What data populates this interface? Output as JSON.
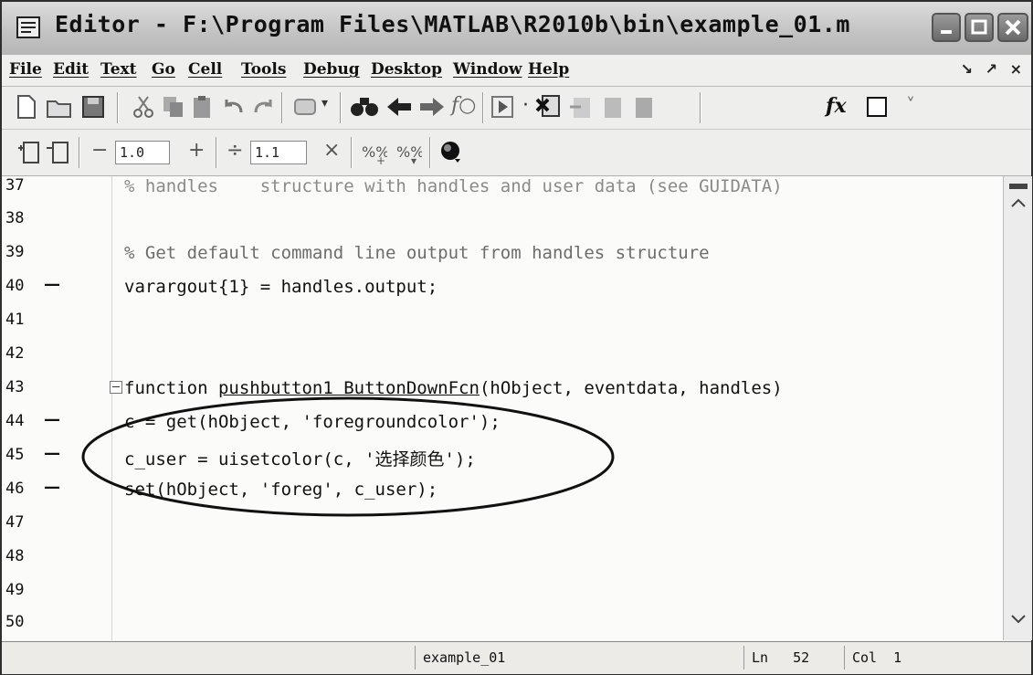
{
  "window": {
    "title": "Editor - F:\\Program Files\\MATLAB\\R2010b\\bin\\example_01.m"
  },
  "menu": [
    "File",
    "Edit",
    "Text",
    "Go",
    "Cell",
    "Tools",
    "Debug",
    "Desktop",
    "Window",
    "Help"
  ],
  "dock_controls": "↘ ↗ ×",
  "toolbar_cell": {
    "minus": "−",
    "value1": "1.0",
    "plus": "+",
    "divide": "÷",
    "value2": "1.1",
    "times": "×"
  },
  "lines": [
    {
      "num": "37",
      "dash": "",
      "code": "% handles    structure with handles and user data (see GUIDATA)"
    },
    {
      "num": "38",
      "dash": "",
      "code": ""
    },
    {
      "num": "39",
      "dash": "",
      "code": "% Get default command line output from handles structure"
    },
    {
      "num": "40",
      "dash": "—",
      "code": "varargout{1} = handles.output;"
    },
    {
      "num": "41",
      "dash": "",
      "code": ""
    },
    {
      "num": "42",
      "dash": "",
      "code": ""
    },
    {
      "num": "43",
      "dash": "",
      "code_pre": "function ",
      "code_ul": "pushbutton1_ButtonDownFcn",
      "code_post": "(hObject, eventdata, handles)"
    },
    {
      "num": "44",
      "dash": "—",
      "code": "c = get(hObject, 'foregroundcolor');"
    },
    {
      "num": "45",
      "dash": "—",
      "code": "c_user = uisetcolor(c, '选择颜色');"
    },
    {
      "num": "46",
      "dash": "—",
      "code": "set(hObject, 'foreg', c_user);"
    },
    {
      "num": "47",
      "dash": "",
      "code": ""
    },
    {
      "num": "48",
      "dash": "",
      "code": ""
    },
    {
      "num": "49",
      "dash": "",
      "code": ""
    },
    {
      "num": "50",
      "dash": "",
      "code": ""
    }
  ],
  "status": {
    "file": "example_01",
    "ln_label": "Ln",
    "ln_value": "52",
    "col_label": "Col",
    "col_value": "1"
  },
  "colors": {
    "titlebar": "#c4c4c4",
    "editor_bg": "#fbfbfa",
    "comment": "#6d6d6d"
  }
}
